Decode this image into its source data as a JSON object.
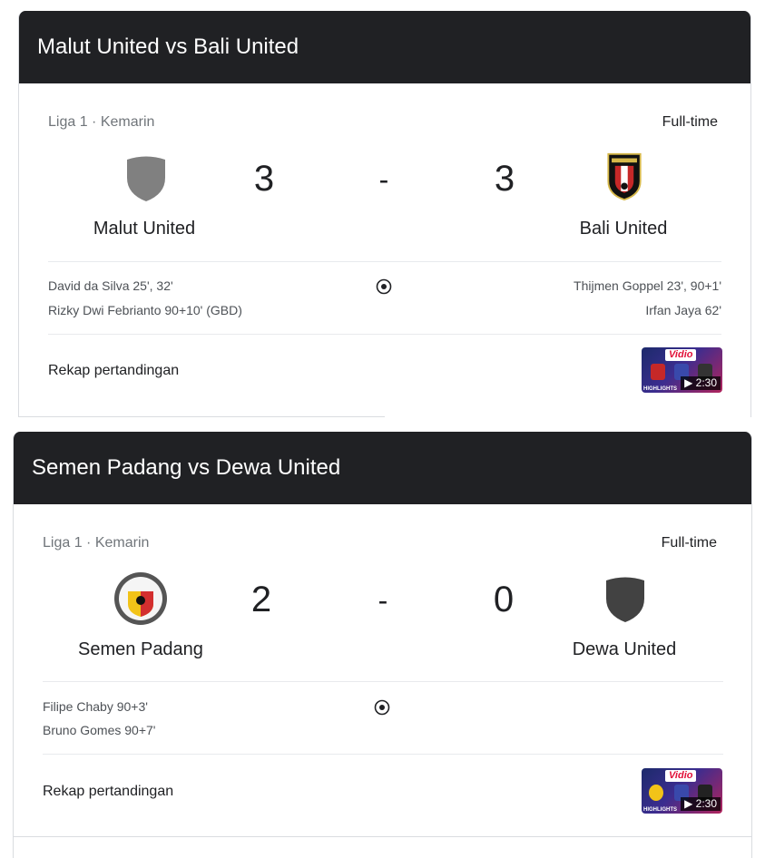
{
  "matches": [
    {
      "title": "Malut United vs Bali United",
      "league": "Liga 1 · Kemarin",
      "status": "Full-time",
      "home": {
        "name": "Malut United",
        "score": "3",
        "logo": "shield-icon-gray"
      },
      "away": {
        "name": "Bali United",
        "score": "3",
        "logo": "bali-united-crest"
      },
      "separator": "-",
      "home_scorers": [
        "David da Silva 25', 32'",
        "Rizky Dwi Febrianto 90+10' (GBD)"
      ],
      "away_scorers": [
        "Thijmen Goppel 23', 90+1'",
        "Irfan Jaya 62'"
      ],
      "recap_label": "Rekap pertandingan",
      "video": {
        "brand": "Vidio",
        "badge": "HIGHLIGHTS",
        "duration": "▶ 2:30"
      }
    },
    {
      "title": "Semen Padang vs Dewa United",
      "league": "Liga 1 · Kemarin",
      "status": "Full-time",
      "home": {
        "name": "Semen Padang",
        "score": "2",
        "logo": "semen-padang-crest"
      },
      "away": {
        "name": "Dewa United",
        "score": "0",
        "logo": "shield-icon-dark"
      },
      "separator": "-",
      "home_scorers": [
        "Filipe Chaby 90+3'",
        "Bruno Gomes 90+7'"
      ],
      "away_scorers": [],
      "recap_label": "Rekap pertandingan",
      "video": {
        "brand": "Vidio",
        "badge": "HIGHLIGHTS",
        "duration": "▶ 2:30"
      }
    }
  ],
  "colors": {
    "header_bg": "#202124",
    "muted": "#70757a",
    "divider": "#e8eaed"
  }
}
